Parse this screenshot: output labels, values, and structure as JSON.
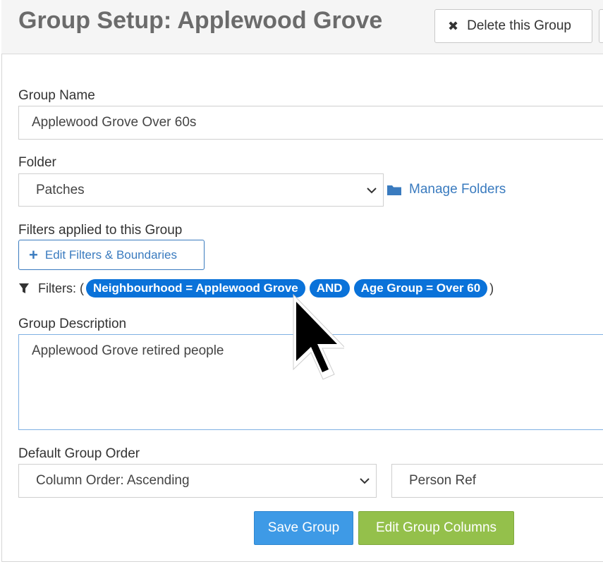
{
  "header": {
    "title": "Group Setup:  Applewood Grove",
    "delete_button": "Delete this Group",
    "delete_icon": "close-icon"
  },
  "form": {
    "group_name": {
      "label": "Group Name",
      "value": "Applewood Grove Over 60s"
    },
    "folder": {
      "label": "Folder",
      "value": "Patches",
      "manage_link": "Manage Folders",
      "icon": "folder-icon"
    },
    "filters": {
      "label": "Filters applied to this Group",
      "edit_button": "Edit Filters & Boundaries",
      "prefix": "Filters: (",
      "suffix": ")",
      "pills": [
        "Neighbourhood = Applewood Grove",
        "AND",
        "Age Group = Over 60"
      ],
      "icon": "funnel-icon"
    },
    "description": {
      "label": "Group Description",
      "value": "Applewood Grove retired people"
    },
    "order": {
      "label": "Default Group Order",
      "direction": "Column Order: Ascending",
      "column": "Person Ref"
    }
  },
  "actions": {
    "save": "Save Group",
    "edit_columns": "Edit Group Columns"
  },
  "colors": {
    "pill": "#0a72d9",
    "link": "#3a7bbf",
    "save": "#3e9ae6",
    "columns": "#94c04b"
  }
}
